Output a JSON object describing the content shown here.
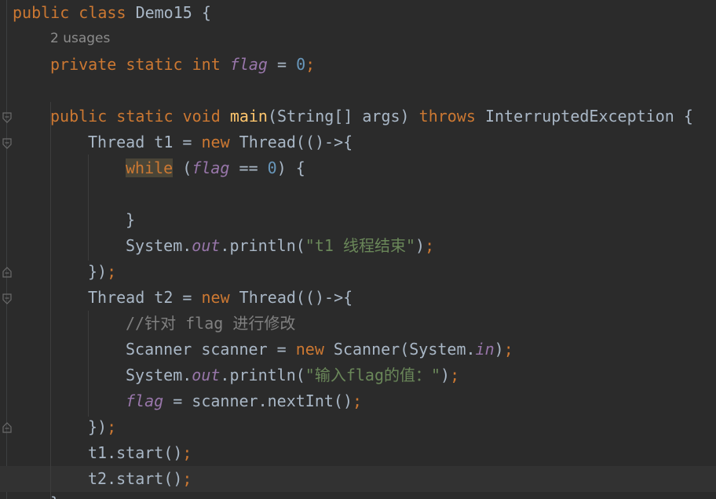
{
  "code": {
    "l1": {
      "public": "public",
      "class": "class",
      "name": "Demo15",
      "brace": "{"
    },
    "usages": "2 usages",
    "l3": {
      "private": "private",
      "static": "static",
      "int": "int",
      "flag": "flag",
      "eq": "=",
      "zero": "0",
      "semi": ";"
    },
    "l5": {
      "public": "public",
      "static": "static",
      "void": "void",
      "main": "main",
      "params": "(String[] args)",
      "throws": "throws",
      "exc": "InterruptedException",
      "brace": "{"
    },
    "l6": {
      "decl": "Thread t1 =",
      "new": "new",
      "rest": "Thread(()->{"
    },
    "l7": {
      "while": "while",
      "open": "(",
      "flag": "flag",
      "cmp": "==",
      "zero": "0",
      "close": ") {"
    },
    "l9": "}",
    "l10": {
      "sys": "System.",
      "out": "out",
      "println": ".println(",
      "str": "\"t1 线程结束\"",
      "close": ")",
      "semi": ";"
    },
    "l11": {
      "close": "})",
      "semi": ";"
    },
    "l12": {
      "decl": "Thread t2 =",
      "new": "new",
      "rest": "Thread(()->{"
    },
    "l13": "//针对 flag 进行修改",
    "l14": {
      "decl": "Scanner scanner =",
      "new": "new",
      "cls": "Scanner(System.",
      "in": "in",
      "close": ")",
      "semi": ";"
    },
    "l15": {
      "sys": "System.",
      "out": "out",
      "println": ".println(",
      "str": "\"输入flag的值：\"",
      "close": ")",
      "semi": ";"
    },
    "l16": {
      "flag": "flag",
      "rest": "= scanner.nextInt()",
      "semi": ";"
    },
    "l17": {
      "close": "})",
      "semi": ";"
    },
    "l18": {
      "call": "t1.start()",
      "semi": ";"
    },
    "l19": {
      "call": "t2.start()",
      "semi": ";"
    },
    "l20": "}"
  },
  "colors": {
    "background": "#2b2b2b",
    "keyword": "#cc7832",
    "method": "#ffc66d",
    "number": "#6897bb",
    "string": "#6a8759",
    "comment": "#808080",
    "field": "#9876aa",
    "text": "#a9b7c6"
  },
  "icons": {
    "fold_open": "fold-open-icon",
    "fold_close": "fold-close-icon"
  }
}
